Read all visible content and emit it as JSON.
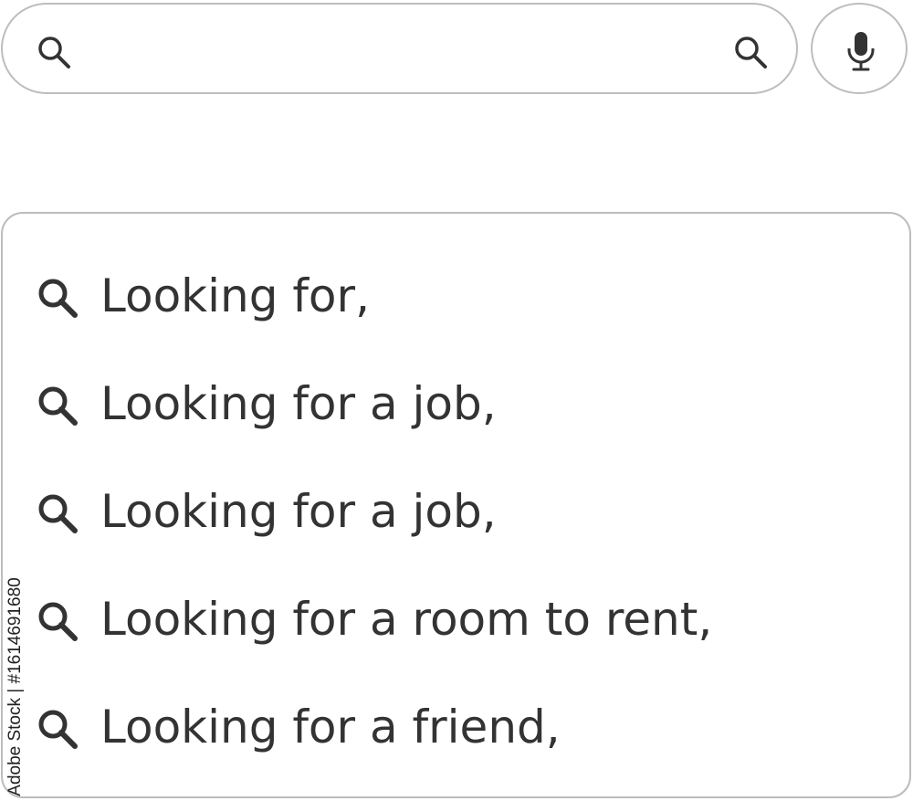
{
  "search_bar": {
    "placeholder": "",
    "value": "",
    "leading_icon": "search-icon",
    "trailing_icon": "search-icon",
    "mic_icon": "microphone-icon"
  },
  "suggestions": [
    {
      "label": "Looking for,",
      "icon": "search-icon"
    },
    {
      "label": "Looking for a job,",
      "icon": "search-icon"
    },
    {
      "label": "Looking for a job,",
      "icon": "search-icon"
    },
    {
      "label": "Looking for a room to rent,",
      "icon": "search-icon"
    },
    {
      "label": "Looking for a friend,",
      "icon": "search-icon"
    }
  ],
  "watermark": "Adobe Stock | #1614691680",
  "colors": {
    "border": "#bdbdbd",
    "text": "#333333",
    "icon": "#333333",
    "background": "#ffffff"
  }
}
